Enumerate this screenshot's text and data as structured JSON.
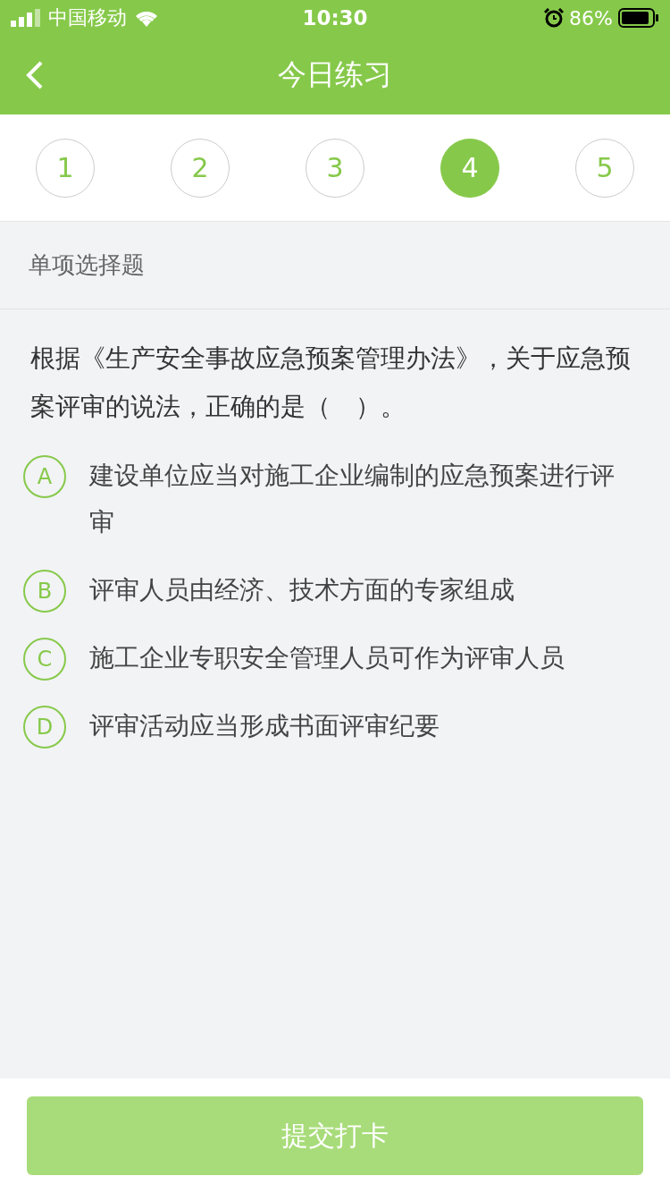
{
  "status_bar": {
    "carrier": "中国移动",
    "time": "10:30",
    "battery": "86%"
  },
  "nav": {
    "title": "今日练习"
  },
  "steps": [
    {
      "label": "1",
      "selected": false
    },
    {
      "label": "2",
      "selected": false
    },
    {
      "label": "3",
      "selected": false
    },
    {
      "label": "4",
      "selected": true
    },
    {
      "label": "5",
      "selected": false
    }
  ],
  "section_title": "单项选择题",
  "question": "根据《生产安全事故应急预案管理办法》，关于应急预案评审的说法，正确的是（　）。",
  "options": [
    {
      "letter": "A",
      "text": "建设单位应当对施工企业编制的应急预案进行评审",
      "selected": false
    },
    {
      "letter": "B",
      "text": "评审人员由经济、技术方面的专家组成",
      "selected": false
    },
    {
      "letter": "C",
      "text": "施工企业专职安全管理人员可作为评审人员",
      "selected": false
    },
    {
      "letter": "D",
      "text": "评审活动应当形成书面评审纪要",
      "selected": false
    }
  ],
  "submit": {
    "label": "提交打卡",
    "disabled": true
  }
}
